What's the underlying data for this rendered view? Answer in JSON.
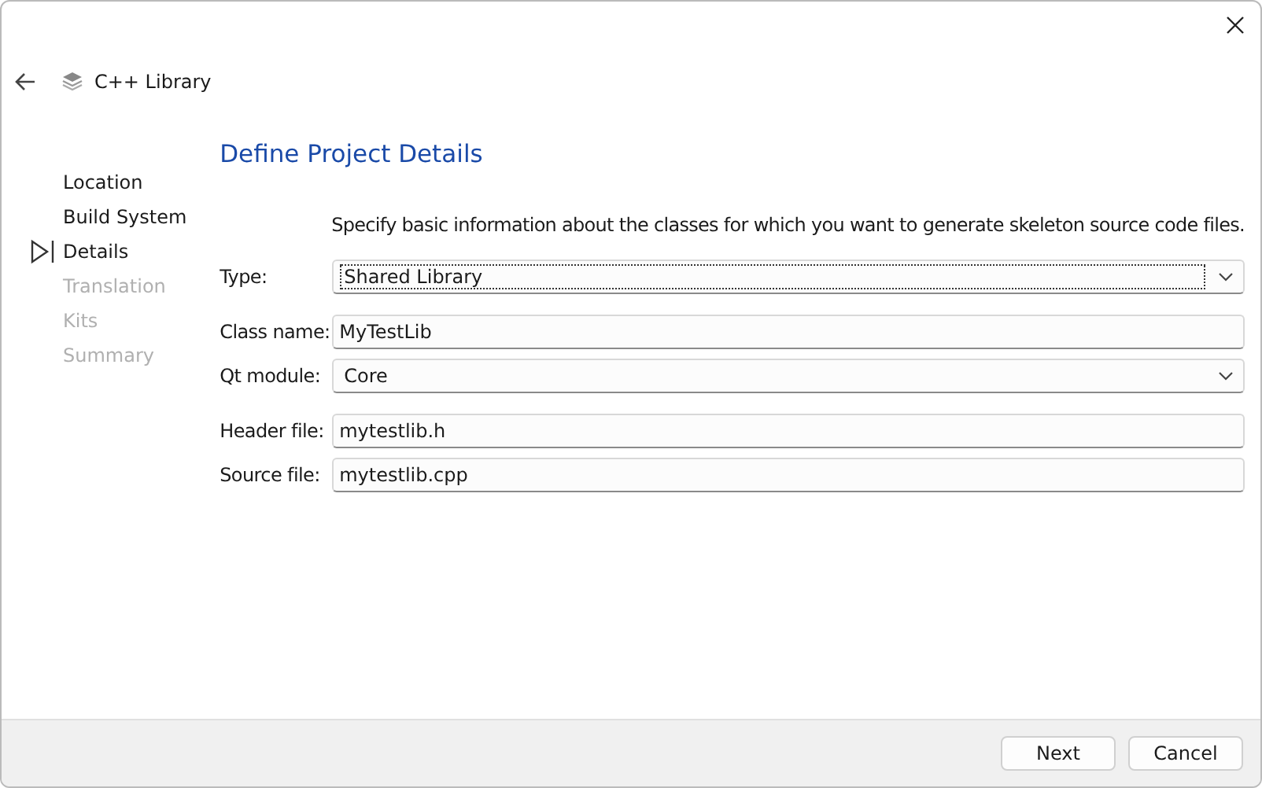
{
  "header": {
    "title": "C++ Library"
  },
  "steps": [
    {
      "label": "Location",
      "selected": false,
      "disabled": false
    },
    {
      "label": "Build System",
      "selected": false,
      "disabled": false
    },
    {
      "label": "Details",
      "selected": true,
      "disabled": false
    },
    {
      "label": "Translation",
      "selected": false,
      "disabled": true
    },
    {
      "label": "Kits",
      "selected": false,
      "disabled": true
    },
    {
      "label": "Summary",
      "selected": false,
      "disabled": true
    }
  ],
  "page": {
    "heading": "Define Project Details",
    "description": "Specify basic information about the classes for which you want to generate skeleton source code files."
  },
  "field_groups": [
    [
      {
        "kind": "combo",
        "label": "Type:",
        "value": "Shared Library",
        "focused": true
      }
    ],
    [
      {
        "kind": "text",
        "label": "Class name:",
        "value": "MyTestLib",
        "focused": false
      },
      {
        "kind": "combo",
        "label": "Qt module:",
        "value": "Core",
        "focused": false
      }
    ],
    [
      {
        "kind": "text",
        "label": "Header file:",
        "value": "mytestlib.h",
        "focused": false
      },
      {
        "kind": "text",
        "label": "Source file:",
        "value": "mytestlib.cpp",
        "focused": false
      }
    ]
  ],
  "buttons": [
    "Next",
    "Cancel"
  ]
}
